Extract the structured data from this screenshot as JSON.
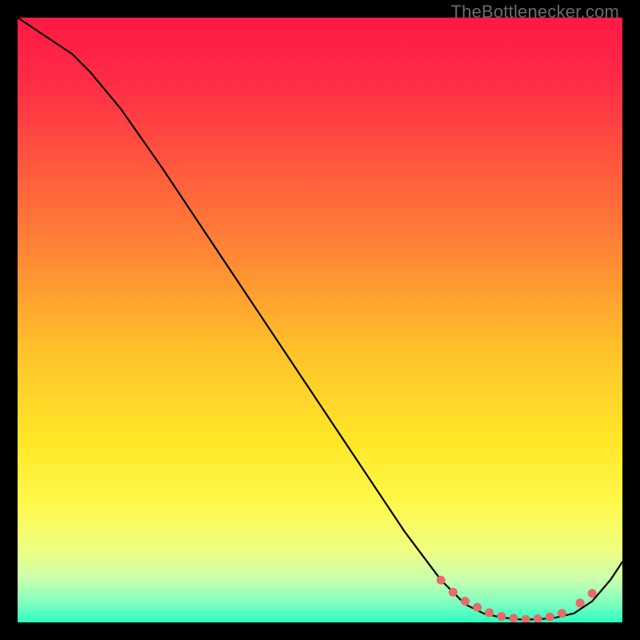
{
  "watermark": "TheBottlenecker.com",
  "gradient": {
    "stops": [
      {
        "offset": 0.0,
        "color": "#ff1a44"
      },
      {
        "offset": 0.1,
        "color": "#ff2a46"
      },
      {
        "offset": 0.25,
        "color": "#ff5a3e"
      },
      {
        "offset": 0.4,
        "color": "#ff8a34"
      },
      {
        "offset": 0.55,
        "color": "#ffc22a"
      },
      {
        "offset": 0.7,
        "color": "#ffe728"
      },
      {
        "offset": 0.8,
        "color": "#fff84a"
      },
      {
        "offset": 0.88,
        "color": "#f0ff80"
      },
      {
        "offset": 0.93,
        "color": "#c8ffb0"
      },
      {
        "offset": 0.97,
        "color": "#7affbe"
      },
      {
        "offset": 1.0,
        "color": "#2affc0"
      }
    ]
  },
  "chart_data": {
    "type": "line",
    "title": "",
    "xlabel": "",
    "ylabel": "",
    "xlim": [
      0,
      100
    ],
    "ylim": [
      0,
      100
    ],
    "series": [
      {
        "name": "curve",
        "x": [
          0,
          3,
          6,
          9,
          12,
          17,
          24,
          32,
          40,
          48,
          56,
          64,
          70,
          74,
          77,
          80,
          83,
          86,
          89,
          92,
          95,
          98,
          100
        ],
        "y": [
          100,
          98,
          96,
          94,
          91,
          85,
          75,
          63,
          51,
          39,
          27,
          15,
          7,
          3,
          1.5,
          0.8,
          0.5,
          0.5,
          0.8,
          1.5,
          3.5,
          7,
          10
        ]
      }
    ],
    "highlight_markers": {
      "name": "optimal-range",
      "color": "#e86a6a",
      "x": [
        70,
        72,
        74,
        76,
        78,
        80,
        82,
        84,
        86,
        88,
        90,
        93,
        95
      ],
      "y": [
        7,
        5,
        3.5,
        2.5,
        1.6,
        1.0,
        0.7,
        0.5,
        0.6,
        0.9,
        1.5,
        3.2,
        4.8
      ]
    }
  }
}
